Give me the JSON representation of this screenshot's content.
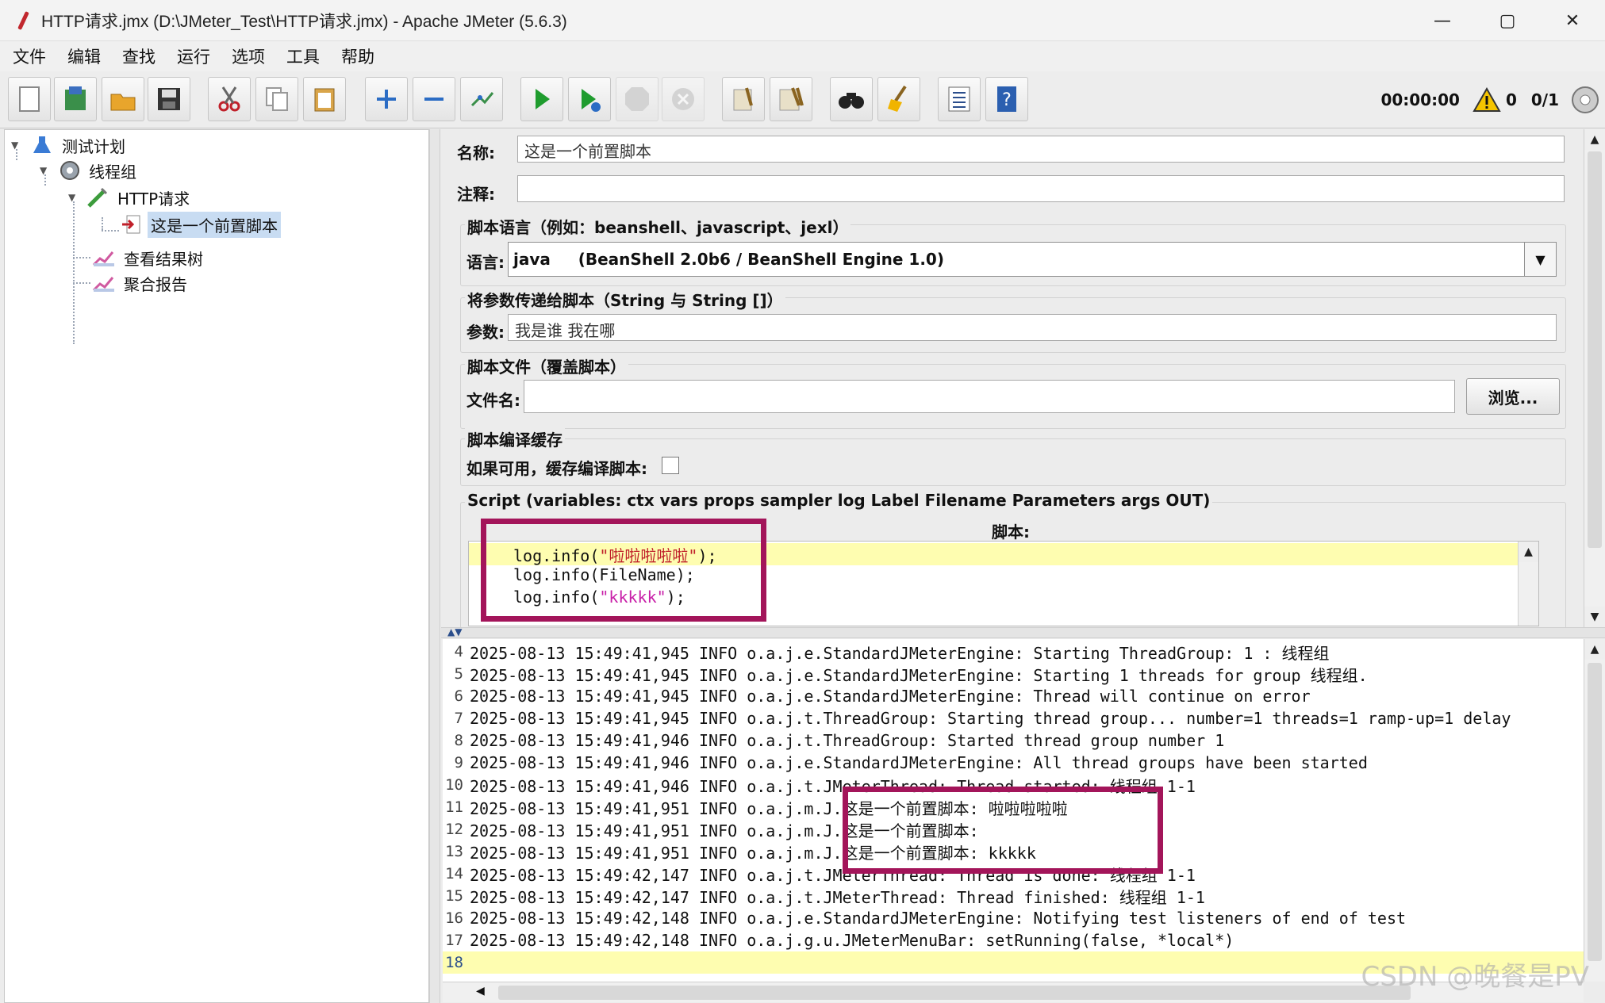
{
  "window": {
    "title": "HTTP请求.jmx (D:\\JMeter_Test\\HTTP请求.jmx) - Apache JMeter (5.6.3)",
    "minimize": "—",
    "maximize": "▢",
    "close": "✕"
  },
  "menu": [
    "文件",
    "编辑",
    "查找",
    "运行",
    "选项",
    "工具",
    "帮助"
  ],
  "toolbar": {
    "icons": [
      "new-icon",
      "templates-icon",
      "open-icon",
      "save-icon",
      "cut-icon",
      "copy-icon",
      "paste-icon",
      "expand-icon",
      "collapse-icon",
      "toggle-icon",
      "start-icon",
      "start-no-pause-icon",
      "stop-icon",
      "shutdown-icon",
      "clear-icon",
      "clear-all-icon",
      "search-icon",
      "reset-search-icon",
      "function-helper-icon",
      "help-icon"
    ],
    "timer": "00:00:00",
    "warning_count": "0",
    "threads": "0/1"
  },
  "tree": {
    "nodes": [
      {
        "label": "测试计划",
        "icon": "test-plan-icon"
      },
      {
        "label": "线程组",
        "icon": "thread-group-icon"
      },
      {
        "label": "HTTP请求",
        "icon": "http-sampler-icon"
      },
      {
        "label": "这是一个前置脚本",
        "icon": "preprocessor-icon",
        "selected": true
      },
      {
        "label": "查看结果树",
        "icon": "listener-icon"
      },
      {
        "label": "聚合报告",
        "icon": "listener-icon"
      }
    ]
  },
  "form": {
    "name_label": "名称:",
    "name_value": "这是一个前置脚本",
    "comment_label": "注释:",
    "comment_value": "",
    "lang_group_title": "脚本语言（例如：beanshell、javascript、jexl）",
    "lang_label": "语言:",
    "lang_value": "java     (BeanShell 2.0b6 / BeanShell Engine 1.0)",
    "params_group_title": "将参数传递给脚本（String 与 String []）",
    "params_label": "参数:",
    "params_value": "我是谁 我在哪",
    "file_group_title": "脚本文件（覆盖脚本）",
    "file_label": "文件名:",
    "file_value": "",
    "browse_button": "浏览...",
    "cache_group_title": "脚本编译缓存",
    "cache_label": "如果可用，缓存编译脚本:",
    "cache_checked": false,
    "script_group_title": "Script (variables: ctx vars props sampler log Label Filename Parameters args OUT)",
    "script_header": "脚本:"
  },
  "script_lines": [
    "log.info(\"啦啦啦啦啦\");",
    "log.info(FileName);",
    "log.info(\"kkkkk\");"
  ],
  "log": {
    "rows": [
      {
        "n": "4",
        "t": "2025-08-13 15:49:41,945 INFO o.a.j.e.StandardJMeterEngine: Starting ThreadGroup: 1 : 线程组"
      },
      {
        "n": "5",
        "t": "2025-08-13 15:49:41,945 INFO o.a.j.e.StandardJMeterEngine: Starting 1 threads for group 线程组."
      },
      {
        "n": "6",
        "t": "2025-08-13 15:49:41,945 INFO o.a.j.e.StandardJMeterEngine: Thread will continue on error"
      },
      {
        "n": "7",
        "t": "2025-08-13 15:49:41,945 INFO o.a.j.t.ThreadGroup: Starting thread group... number=1 threads=1 ramp-up=1 delay"
      },
      {
        "n": "8",
        "t": "2025-08-13 15:49:41,946 INFO o.a.j.t.ThreadGroup: Started thread group number 1"
      },
      {
        "n": "9",
        "t": "2025-08-13 15:49:41,946 INFO o.a.j.e.StandardJMeterEngine: All thread groups have been started"
      },
      {
        "n": "10",
        "t": "2025-08-13 15:49:41,946 INFO o.a.j.t.JMeterThread: Thread started: 线程组 1-1"
      },
      {
        "n": "11",
        "t": "2025-08-13 15:49:41,951 INFO o.a.j.m.J.这是一个前置脚本: 啦啦啦啦啦"
      },
      {
        "n": "12",
        "t": "2025-08-13 15:49:41,951 INFO o.a.j.m.J.这是一个前置脚本:"
      },
      {
        "n": "13",
        "t": "2025-08-13 15:49:41,951 INFO o.a.j.m.J.这是一个前置脚本: kkkkk"
      },
      {
        "n": "14",
        "t": "2025-08-13 15:49:42,147 INFO o.a.j.t.JMeterThread: Thread is done: 线程组 1-1"
      },
      {
        "n": "15",
        "t": "2025-08-13 15:49:42,147 INFO o.a.j.t.JMeterThread: Thread finished: 线程组 1-1"
      },
      {
        "n": "16",
        "t": "2025-08-13 15:49:42,148 INFO o.a.j.e.StandardJMeterEngine: Notifying test listeners of end of test"
      },
      {
        "n": "17",
        "t": "2025-08-13 15:49:42,148 INFO o.a.j.g.u.JMeterMenuBar: setRunning(false, *local*)"
      },
      {
        "n": "18",
        "t": ""
      }
    ]
  },
  "watermark": "CSDN @晚餐是PV",
  "colors": {
    "highlight_box": "#a3155a",
    "current_line": "#fefdb0",
    "tree_selection": "#c8dcf2"
  }
}
